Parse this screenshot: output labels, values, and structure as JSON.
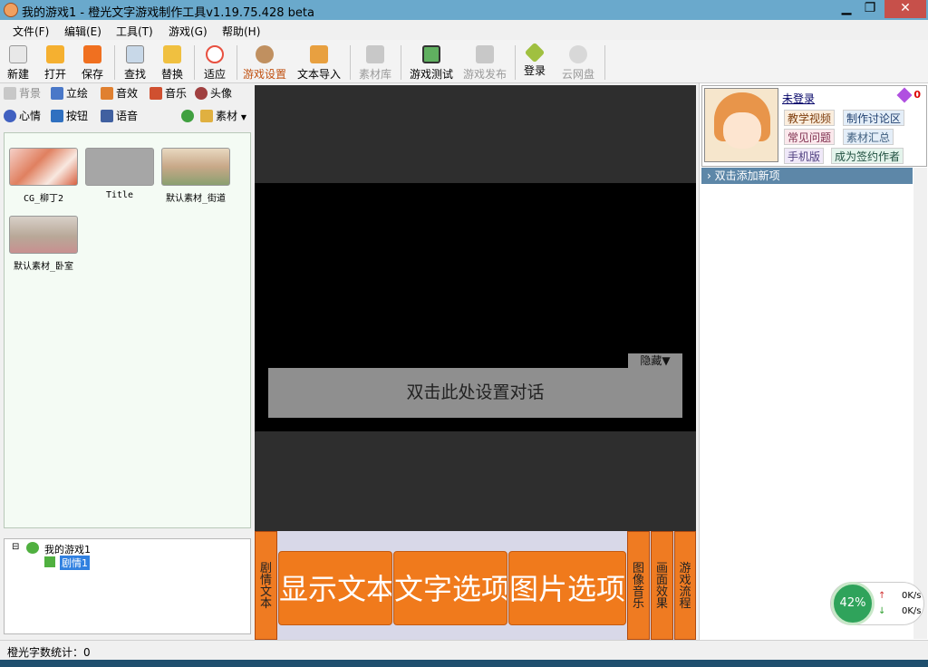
{
  "window": {
    "title": "我的游戏1 - 橙光文字游戏制作工具v1.19.75.428 beta",
    "min_glyph": "▁",
    "max_glyph": "❐",
    "close_glyph": "✕"
  },
  "menu": [
    "文件(F)",
    "编辑(E)",
    "工具(T)",
    "游戏(G)",
    "帮助(H)"
  ],
  "toolbar": [
    {
      "label": "新建",
      "icon": "new-file-icon",
      "color": "#e8e8e8",
      "enabled": true
    },
    {
      "label": "打开",
      "icon": "open-folder-icon",
      "color": "#f5b030",
      "enabled": true
    },
    {
      "label": "保存",
      "icon": "save-icon",
      "color": "#f07020",
      "enabled": true
    },
    {
      "label": "查找",
      "icon": "find-icon",
      "color": "#c8d8e8",
      "enabled": true
    },
    {
      "label": "替换",
      "icon": "replace-icon",
      "color": "#f0c040",
      "enabled": true
    },
    {
      "label": "适应",
      "icon": "fit-icon",
      "color": "#e85040",
      "enabled": true
    },
    {
      "label": "游戏设置",
      "icon": "gear-icon",
      "color": "#c09060",
      "enabled": true
    },
    {
      "label": "文本导入",
      "icon": "text-import-icon",
      "color": "#e8a040",
      "enabled": true
    },
    {
      "label": "素材库",
      "icon": "library-icon",
      "color": "#c8c8c8",
      "enabled": false
    },
    {
      "label": "游戏测试",
      "icon": "test-play-icon",
      "color": "#60b060",
      "enabled": true
    },
    {
      "label": "游戏发布",
      "icon": "publish-icon",
      "color": "#c8c8c8",
      "enabled": false
    },
    {
      "label": "登录",
      "icon": "login-star-icon",
      "color": "#a0c040",
      "enabled": true
    },
    {
      "label": "云网盘",
      "icon": "cloud-disk-icon",
      "color": "#d8d8d8",
      "enabled": false
    }
  ],
  "resource_tabs": {
    "row1": [
      "背景",
      "立绘",
      "音效",
      "音乐",
      "头像"
    ],
    "row2": [
      "心情",
      "按钮",
      "语音",
      "素材"
    ]
  },
  "assets": [
    {
      "name": "CG_柳丁2"
    },
    {
      "name": "Title"
    },
    {
      "name": "默认素材_街道"
    },
    {
      "name": "默认素材_卧室"
    }
  ],
  "tree": {
    "expander": "⊟",
    "root": "我的游戏1",
    "child": "剧情1"
  },
  "stage": {
    "dialog_text": "双击此处设置对话",
    "hide_button": "隐藏▼"
  },
  "commands": {
    "story_text": "剧情文本",
    "show_text": "显示文本",
    "text_option": "文字选项",
    "image_option": "图片选项",
    "image_music": "图像音乐",
    "screen_effect": "画面效果",
    "game_flow": "游戏流程"
  },
  "user": {
    "login_status": "未登录",
    "gem_count": "0",
    "links": [
      "教学视频",
      "制作讨论区",
      "常见问题",
      "素材汇总",
      "手机版",
      "成为签约作者"
    ]
  },
  "right_panel": {
    "add_item": "双击添加新项"
  },
  "perf": {
    "percent": "42%",
    "up_speed": "0K/s",
    "down_speed": "0K/s"
  },
  "status": {
    "word_count": "橙光字数统计：0"
  }
}
